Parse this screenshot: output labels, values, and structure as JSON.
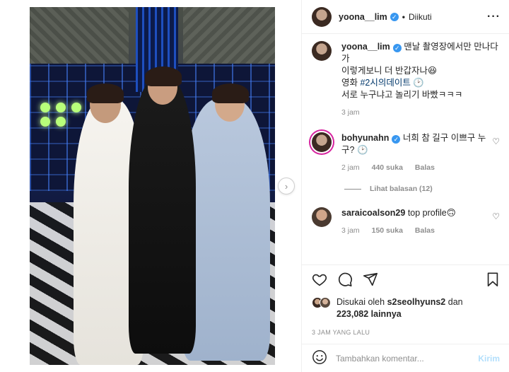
{
  "header": {
    "username": "yoona__lim",
    "separator": "•",
    "follow_status": "Diikuti"
  },
  "caption": {
    "username": "yoona__lim",
    "line1": "맨날 촬영장에서만 만나다가",
    "line2": "이렇게보니 더 반갑자나😆",
    "line3_prefix": "영화 ",
    "hashtag": "#2시의데이트",
    "line4": "서로 누구냐고 놀리기 바빴ㅋㅋㅋ",
    "time": "3 jam"
  },
  "comments": [
    {
      "username": "bohyunahn",
      "text": "너희 참 길구 이쁘구 누구?",
      "time": "2 jam",
      "likes": "440 suka",
      "reply_label": "Balas",
      "view_replies": "Lihat balasan (12)"
    },
    {
      "username": "saraicoalson29",
      "text": "top profile🙃",
      "time": "3 jam",
      "likes": "150 suka",
      "reply_label": "Balas"
    }
  ],
  "likes": {
    "prefix": "Disukai oleh ",
    "user": "s2seolhyuns2",
    "middle": " dan",
    "count": "223,082 lainnya"
  },
  "post_time": "3 JAM YANG LALU",
  "add_comment": {
    "placeholder": "Tambahkan komentar...",
    "send_label": "Kirim"
  },
  "icons": {
    "more": "more-options-icon",
    "like": "heart-icon",
    "comment": "comment-icon",
    "share": "send-icon",
    "save": "bookmark-icon",
    "emoji": "emoji-icon",
    "next": "chevron-right-icon"
  },
  "colors": {
    "verified": "#3897f0",
    "link": "#00376b",
    "muted": "#8e8e8e",
    "send_disabled": "#b2dffc"
  }
}
